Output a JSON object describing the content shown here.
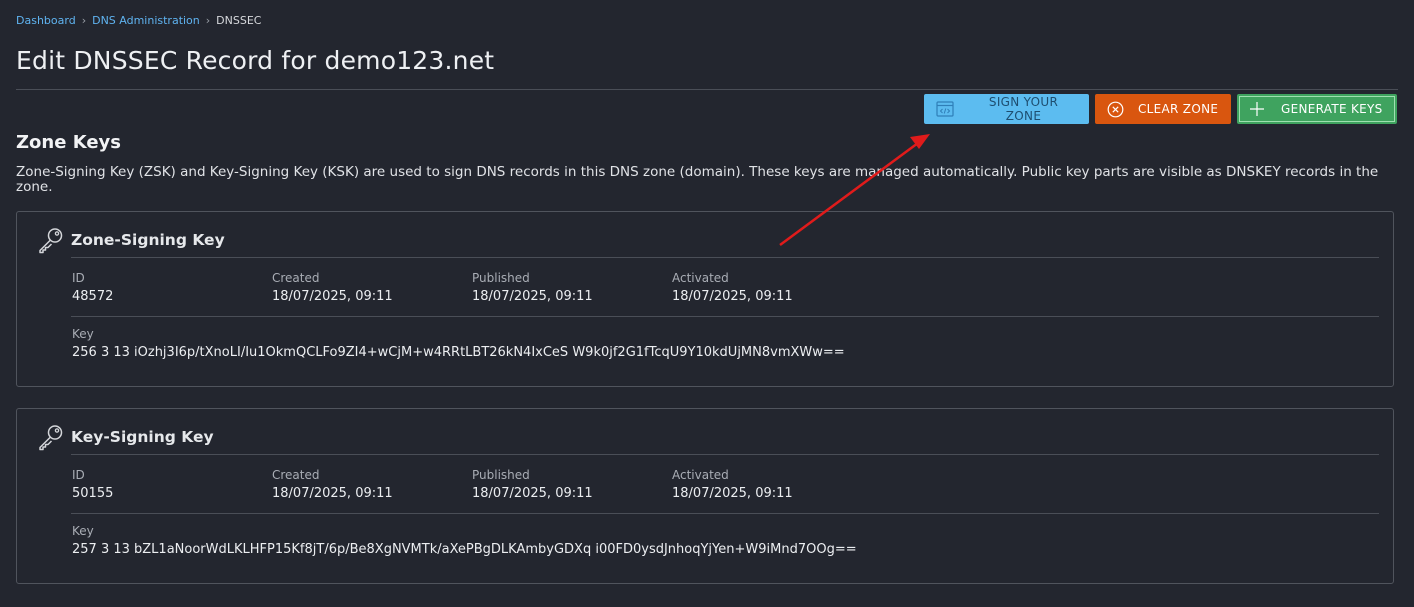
{
  "breadcrumb": {
    "items": [
      "Dashboard",
      "DNS Administration"
    ],
    "current": "DNSSEC"
  },
  "page_title": "Edit DNSSEC Record for demo123.net",
  "actions": {
    "sign_zone": "SIGN YOUR ZONE",
    "clear_zone": "CLEAR ZONE",
    "generate_keys": "GENERATE KEYS"
  },
  "section": {
    "title": "Zone Keys",
    "description": "Zone-Signing Key (ZSK) and Key-Signing Key (KSK) are used to sign DNS records in this DNS zone (domain). These keys are managed automatically. Public key parts are visible as DNSKEY records in the zone."
  },
  "labels": {
    "id": "ID",
    "created": "Created",
    "published": "Published",
    "activated": "Activated",
    "key": "Key"
  },
  "zsk": {
    "title": "Zone-Signing Key",
    "id": "48572",
    "created": "18/07/2025, 09:11",
    "published": "18/07/2025, 09:11",
    "activated": "18/07/2025, 09:11",
    "key": "256 3 13 iOzhj3I6p/tXnoLI/Iu1OkmQCLFo9ZI4+wCjM+w4RRtLBT26kN4IxCeS W9k0jf2G1fTcqU9Y10kdUjMN8vmXWw=="
  },
  "ksk": {
    "title": "Key-Signing Key",
    "id": "50155",
    "created": "18/07/2025, 09:11",
    "published": "18/07/2025, 09:11",
    "activated": "18/07/2025, 09:11",
    "key": "257 3 13 bZL1aNoorWdLKLHFP15Kf8jT/6p/Be8XgNVMTk/aXePBgDLKAmbyGDXq i00FD0ysdJnhoqYjYen+W9iMnd7OOg=="
  },
  "colors": {
    "background": "#23262f",
    "link": "#5fb3f0",
    "sign_button": "#5cbcf0",
    "clear_button": "#d9560f",
    "generate_button": "#3fa35f",
    "arrow": "#e01b1b"
  },
  "icons": {
    "sign_zone": "code-window-icon",
    "clear_zone": "close-circle-icon",
    "generate_keys": "plus-icon",
    "key_card": "key-icon"
  }
}
